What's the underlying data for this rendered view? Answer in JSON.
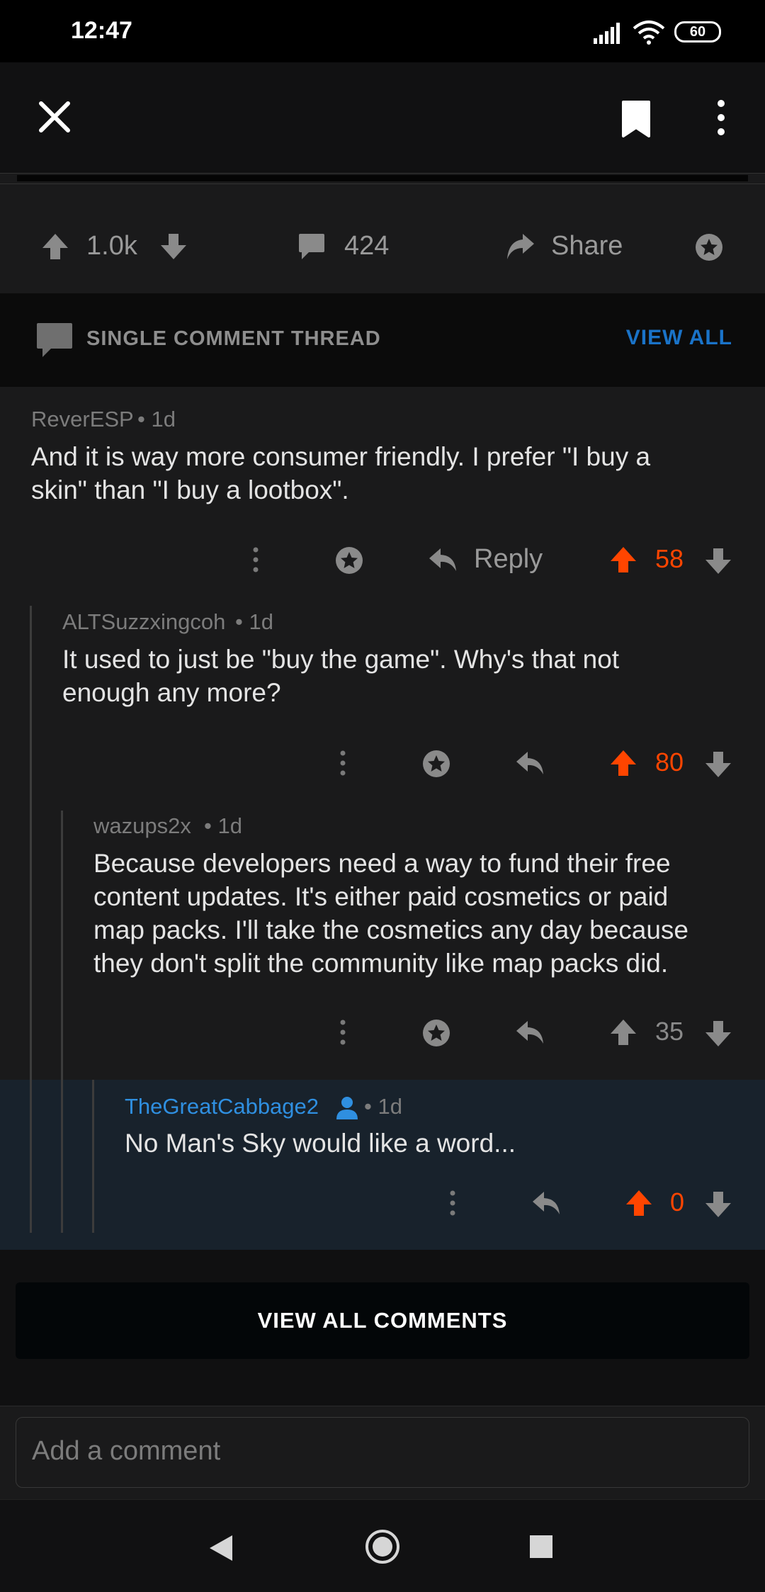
{
  "status_bar": {
    "time": "12:47",
    "battery": "60"
  },
  "actions": {
    "upvotes": "1.0k",
    "comments": "424",
    "share_label": "Share"
  },
  "thread_header": {
    "title": "SINGLE COMMENT THREAD",
    "view_all": "VIEW ALL"
  },
  "comments": [
    {
      "author": "ReverESP",
      "age": "1d",
      "body_lines": [
        "And it is way more consumer friendly. I prefer \"I buy a",
        "skin\" than \"I buy a lootbox\"."
      ],
      "reply_label": "Reply",
      "score": "58"
    },
    {
      "author": "ALTSuzzxingcoh",
      "age": "1d",
      "body_lines": [
        "It used to just be \"buy the game\". Why's that not",
        "enough any more?"
      ],
      "score": "80"
    },
    {
      "author": "wazups2x",
      "age": "1d",
      "body_lines": [
        "Because developers need a way to fund their free",
        "content updates. It's either paid cosmetics or paid",
        "map packs. I'll take the cosmetics any day because",
        "they don't split the community like map packs did."
      ],
      "score": "35"
    },
    {
      "author": "TheGreatCabbage2",
      "age": "1d",
      "body_lines": [
        "No Man's Sky would like a word..."
      ],
      "score": "0"
    }
  ],
  "view_all_comments": "VIEW ALL COMMENTS",
  "comment_input": {
    "placeholder": "Add a comment"
  },
  "colors": {
    "accent_orange": "#ff4500",
    "link_blue": "#1a73c8",
    "author_blue": "#2f8fe0"
  },
  "icons": [
    "close-icon",
    "bookmark-icon",
    "more-vertical-icon",
    "upvote-icon",
    "downvote-icon",
    "comment-icon",
    "share-icon",
    "award-icon",
    "reply-icon",
    "back-nav-icon",
    "home-nav-icon",
    "recents-nav-icon"
  ]
}
